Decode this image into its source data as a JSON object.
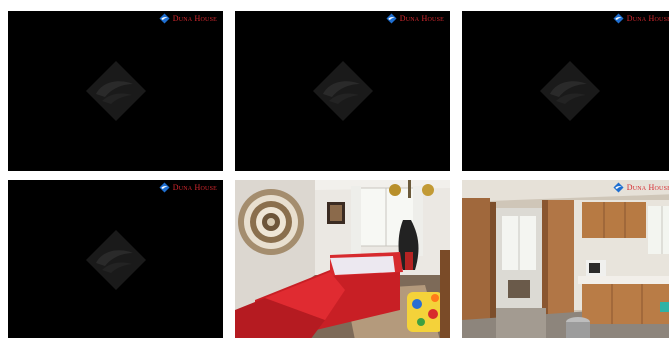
{
  "brand": {
    "name": "Duna House",
    "text_color": "#d6282e",
    "logo_icon": "duna-house-logo-icon"
  },
  "gallery": {
    "tiles": [
      {
        "kind": "placeholder",
        "watermark_icon": "duna-house-watermark-icon"
      },
      {
        "kind": "placeholder",
        "watermark_icon": "duna-house-watermark-icon"
      },
      {
        "kind": "placeholder",
        "watermark_icon": "duna-house-watermark-icon"
      },
      {
        "kind": "placeholder",
        "watermark_icon": "duna-house-watermark-icon"
      },
      {
        "kind": "photo",
        "subject": "bedroom-photo"
      },
      {
        "kind": "photo",
        "subject": "kitchen-photo"
      }
    ]
  }
}
